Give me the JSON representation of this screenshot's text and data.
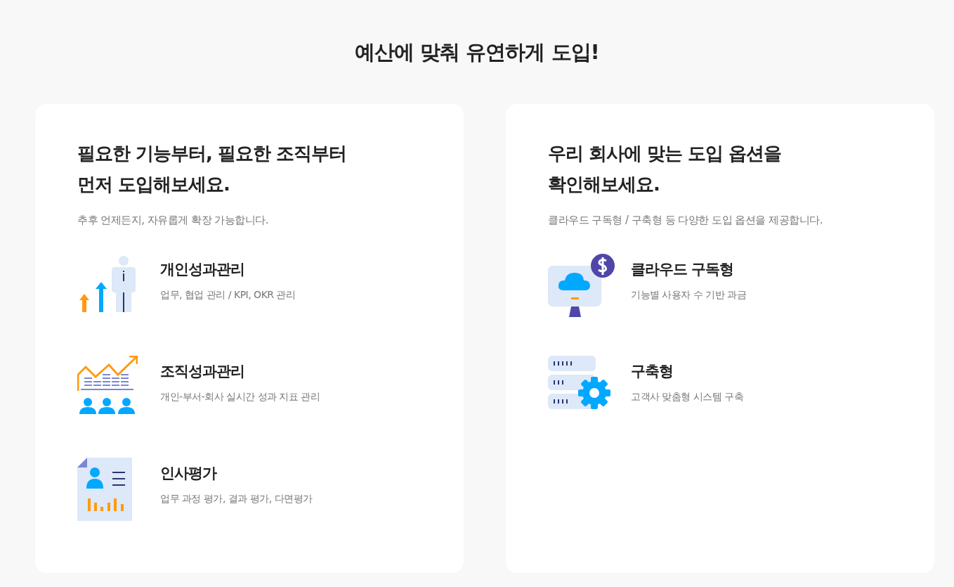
{
  "title": "예산에 맞춰 유연하게 도입!",
  "cards": [
    {
      "heading_lines": [
        "필요한 기능부터, 필요한 조직부터",
        "먼저 도입해보세요."
      ],
      "subtitle": "추후 언제든지, 자유롭게 확장 가능합니다.",
      "items": [
        {
          "title": "개인성과관리",
          "description": "업무, 협업 관리 / KPI, OKR 관리"
        },
        {
          "title": "조직성과관리",
          "description": "개인-부서-회사 실시간 성과 지표 관리"
        },
        {
          "title": "인사평가",
          "description": "업무 과정 평가, 결과 평가, 다면평가"
        }
      ]
    },
    {
      "heading_lines": [
        "우리 회사에 맞는 도입 옵션을",
        "확인해보세요."
      ],
      "subtitle": "클라우드 구독형 / 구축형 등 다양한 도입 옵션을 제공합니다.",
      "items": [
        {
          "title": "클라우드 구독형",
          "description": "기능별 사용자 수 기반 과금"
        },
        {
          "title": "구축형",
          "description": "고객사 맞춤형 시스템 구축"
        }
      ]
    }
  ]
}
